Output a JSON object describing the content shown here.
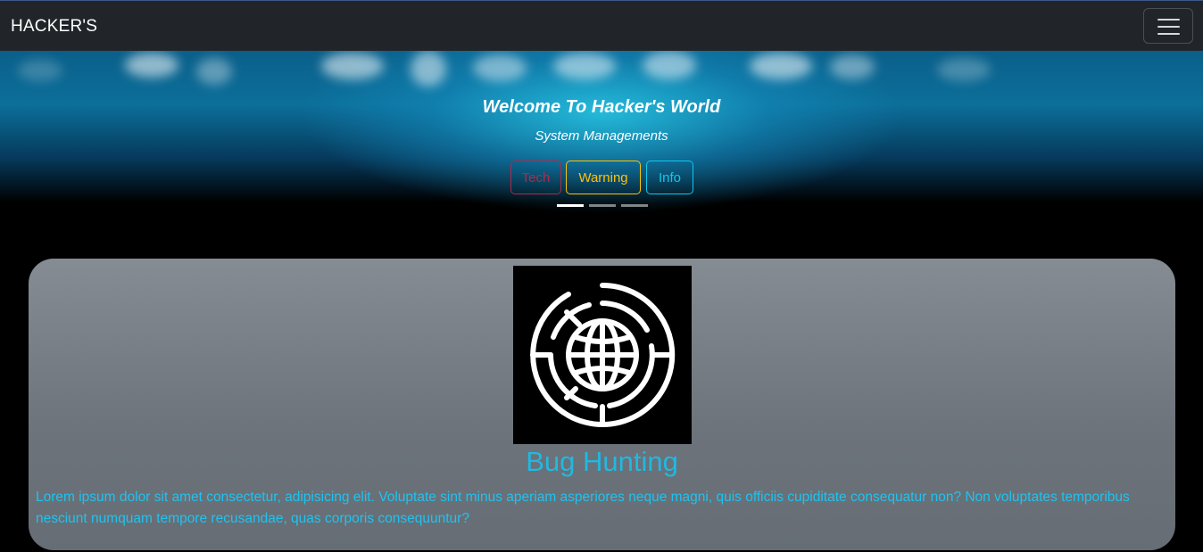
{
  "navbar": {
    "brand": "HACKER'S",
    "toggler_icon": "hamburger-menu-icon"
  },
  "hero": {
    "title": "Welcome To Hacker's World",
    "subtitle": "System Managements",
    "buttons": {
      "tech": "Tech",
      "warning": "Warning",
      "info": "Info"
    },
    "slides": {
      "count": 3,
      "active": 1
    }
  },
  "card": {
    "icon": "globe-maze-icon",
    "title": "Bug Hunting",
    "text": "Lorem ipsum dolor sit amet consectetur, adipisicing elit. Voluptate sint minus aperiam asperiores neque magni, quis officiis cupiditate consequatur non? Non voluptates temporibus nesciunt numquam tempore recusandae, quas corporis consequuntur?"
  },
  "colors": {
    "navbar_bg": "#212529",
    "tech": "#b02a4a",
    "warning": "#ffc107",
    "info": "#0dcaf0",
    "card_text": "#1fc3f0"
  }
}
